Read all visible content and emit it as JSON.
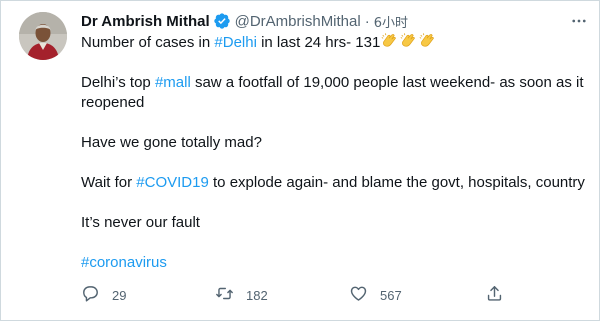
{
  "tweet": {
    "author_name": "Dr Ambrish Mithal",
    "handle": "@DrAmbrishMithal",
    "separator": "·",
    "time": "6小时",
    "lines": {
      "l1_prefix": "Number of cases in ",
      "l1_tag": "#Delhi",
      "l1_suffix": " in last 24 hrs- 131",
      "l2_prefix": "Delhi’s top ",
      "l2_tag": "#mall",
      "l2_suffix": " saw a footfall of 19,000 people last weekend- as soon as it reopened",
      "l3": "Have we gone totally mad?",
      "l4_prefix": "Wait for ",
      "l4_tag": "#COVID19",
      "l4_suffix": " to explode again- and blame the govt, hospitals, country",
      "l5": "It’s never our fault",
      "l6_tag": "#coronavirus"
    },
    "emoji": [
      "clapping-hands",
      "clapping-hands",
      "clapping-hands"
    ],
    "actions": {
      "reply_count": "29",
      "retweet_count": "182",
      "like_count": "567"
    }
  },
  "colors": {
    "link": "#1d9bf0",
    "text": "#0f1419",
    "secondary": "#536471",
    "border": "#cfd9de"
  }
}
